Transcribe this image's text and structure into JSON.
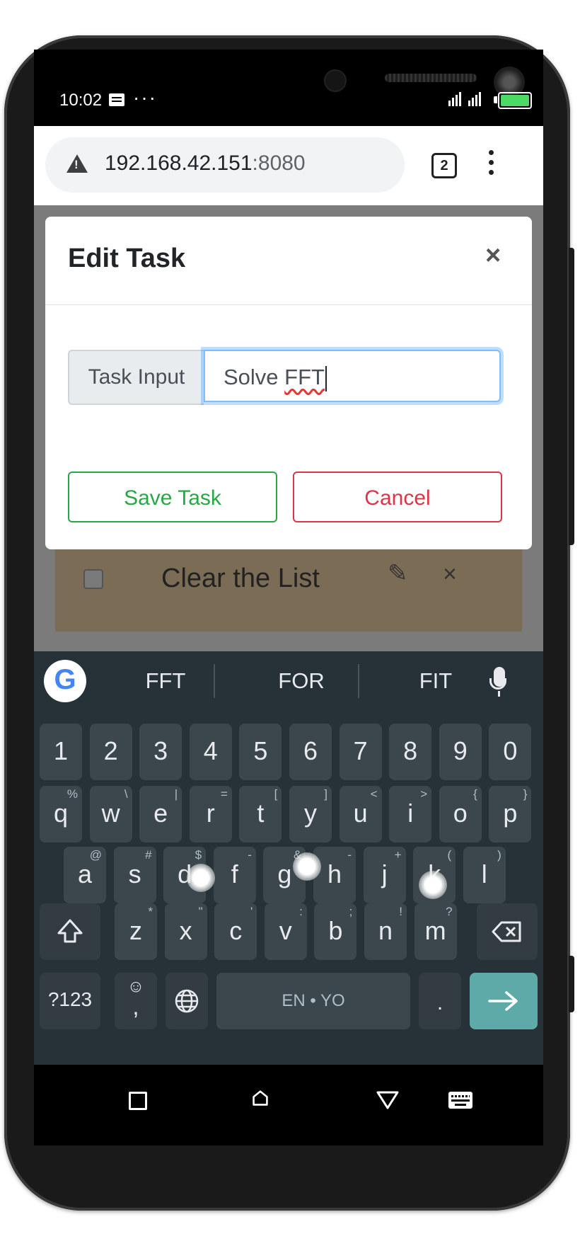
{
  "status_bar": {
    "time": "10:02",
    "more": "···",
    "signal_text": "⁴ᴳ|.|| .||"
  },
  "browser": {
    "url_host": "192.168.42.151",
    "url_port": ":8080",
    "tab_count": "2"
  },
  "modal": {
    "title": "Edit Task",
    "close": "×",
    "input_label": "Task Input",
    "input_prefix": "Solve ",
    "input_typed": "FFT",
    "save_label": "Save Task",
    "cancel_label": "Cancel"
  },
  "background_list": {
    "item_title": "Clear the List"
  },
  "keyboard": {
    "suggestions": [
      "FFT",
      "FOR",
      "FIT"
    ],
    "number_row": [
      "1",
      "2",
      "3",
      "4",
      "5",
      "6",
      "7",
      "8",
      "9",
      "0"
    ],
    "row1": [
      {
        "k": "q",
        "s": "%"
      },
      {
        "k": "w",
        "s": "\\"
      },
      {
        "k": "e",
        "s": "|"
      },
      {
        "k": "r",
        "s": "="
      },
      {
        "k": "t",
        "s": "["
      },
      {
        "k": "y",
        "s": "]"
      },
      {
        "k": "u",
        "s": "<"
      },
      {
        "k": "i",
        "s": ">"
      },
      {
        "k": "o",
        "s": "{"
      },
      {
        "k": "p",
        "s": "}"
      }
    ],
    "row2": [
      {
        "k": "a",
        "s": "@"
      },
      {
        "k": "s",
        "s": "#"
      },
      {
        "k": "d",
        "s": "$"
      },
      {
        "k": "f",
        "s": "-"
      },
      {
        "k": "g",
        "s": "&"
      },
      {
        "k": "h",
        "s": "-"
      },
      {
        "k": "j",
        "s": "+"
      },
      {
        "k": "k",
        "s": "("
      },
      {
        "k": "l",
        "s": ")"
      }
    ],
    "row3": [
      {
        "k": "z",
        "s": "*"
      },
      {
        "k": "x",
        "s": "\""
      },
      {
        "k": "c",
        "s": "'"
      },
      {
        "k": "v",
        "s": ":"
      },
      {
        "k": "b",
        "s": ";"
      },
      {
        "k": "n",
        "s": "!"
      },
      {
        "k": "m",
        "s": "?"
      }
    ],
    "symbols_label": "?123",
    "comma": ",",
    "space_label": "EN • YO",
    "period": "."
  }
}
